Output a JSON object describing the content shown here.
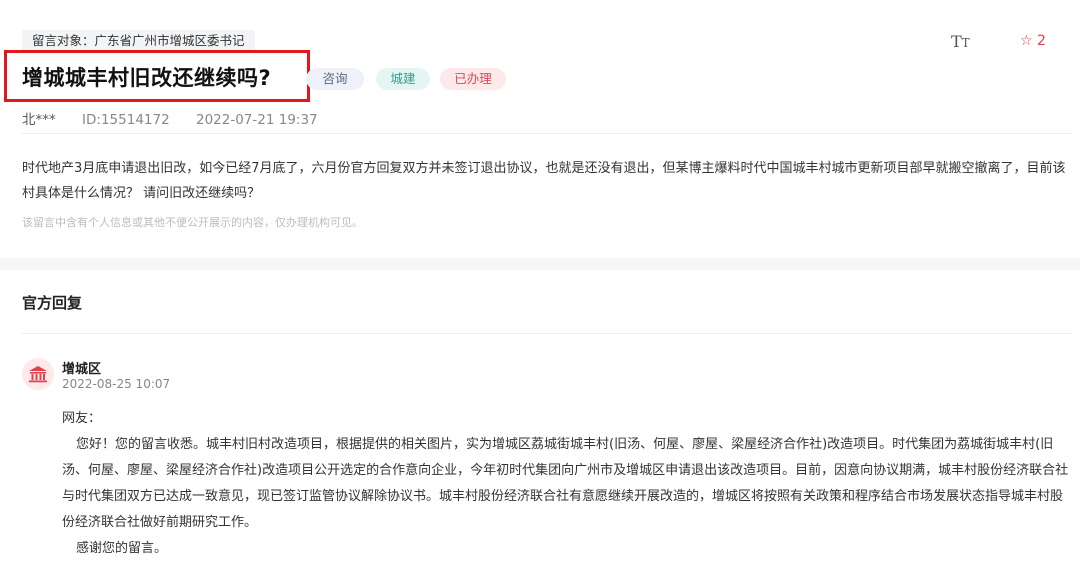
{
  "message": {
    "recipient": "留言对象：广东省广州市增城区委书记",
    "title": "增城城丰村旧改还继续吗?",
    "tags": [
      "咨询",
      "城建",
      "已办理"
    ],
    "author": "北***",
    "id": "ID:15514172",
    "datetime": "2022-07-21 19:37",
    "body": "时代地产3月底申请退出旧改，如今已经7月底了，六月份官方回复双方并未签订退出协议，也就是还没有退出，但某博主爆料时代中国城丰村城市更新项目部早就搬空撤离了，目前该村具体是什么情况？ 请问旧改还继续吗？",
    "privacy_note": "该留言中含有个人信息或其他不便公开展示的内容，仅办理机构可见。"
  },
  "toolbar": {
    "font_size_glyph_big": "T",
    "font_size_glyph_small": "T",
    "star_icon": "☆",
    "star_count": "2"
  },
  "reply": {
    "section_title": "官方回复",
    "org": "增城区",
    "datetime": "2022-08-25 10:07",
    "greeting": "网友：",
    "paragraph": "您好！您的留言收悉。城丰村旧村改造项目，根据提供的相关图片，实为增城区荔城街城丰村(旧汤、何屋、廖屋、梁屋经济合作社)改造项目。时代集团为荔城街城丰村(旧汤、何屋、廖屋、梁屋经济合作社)改造项目公开选定的合作意向企业，今年初时代集团向广州市及增城区申请退出该改造项目。目前，因意向协议期满，城丰村股份经济联合社与时代集团双方已达成一致意见，现已签订监管协议解除协议书。城丰村股份经济联合社有意愿继续开展改造的，增城区将按照有关政策和程序结合市场发展状态指导城丰村股份经济联合社做好前期研究工作。",
    "closing": "感谢您的留言。"
  },
  "colors": {
    "highlight_border": "#e0191b",
    "tag_consult_bg": "#eef2f8",
    "tag_construction_bg": "#e4f5f3",
    "tag_done_bg": "#fde9ea",
    "accent_red": "#e0404a"
  }
}
